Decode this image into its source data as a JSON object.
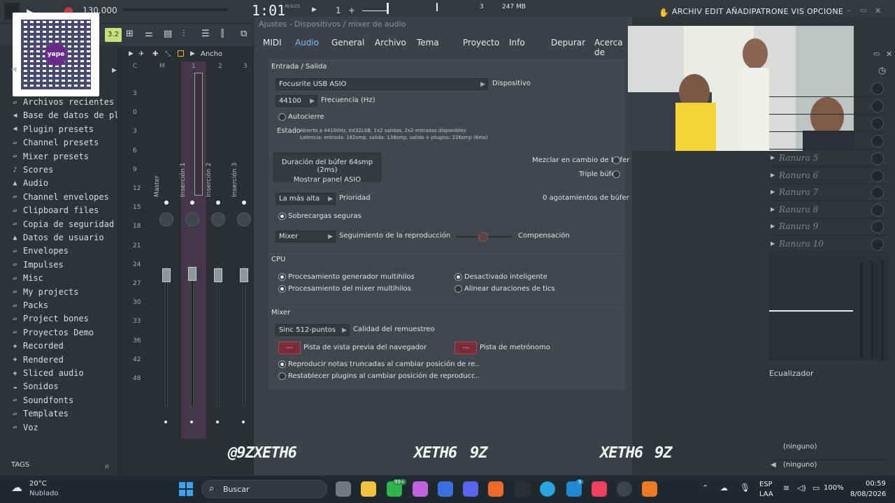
{
  "topbar": {
    "time_display": "1:01",
    "time_unit": "M:S:CS",
    "tempo": "130.000",
    "pattern": "1",
    "cpu_count": "3",
    "memory": "247 MB",
    "menu_title": "ARCHIV EDIT AÑADIPATRONE VIS OPCIONE HERRAMIENT A"
  },
  "toolbar": {
    "zoom_label": "3.2",
    "width_label": "Ancho"
  },
  "sidebar": {
    "qr_brand": "yape",
    "qr_caption": "Archivos recientes",
    "items": [
      {
        "icon": "folder-icon",
        "label": "Archivos recientes"
      },
      {
        "icon": "plug-icon",
        "label": "Base de datos de plugins"
      },
      {
        "icon": "plug-icon",
        "label": "Plugin presets"
      },
      {
        "icon": "folder-icon",
        "label": "Channel presets"
      },
      {
        "icon": "folder-icon",
        "label": "Mixer presets"
      },
      {
        "icon": "note-icon",
        "label": "Scores"
      },
      {
        "icon": "speaker-icon",
        "label": "Audio"
      },
      {
        "icon": "folder-icon",
        "label": "Channel envelopes"
      },
      {
        "icon": "folder-icon",
        "label": "Clipboard files"
      },
      {
        "icon": "folder-icon",
        "label": "Copia de seguridad"
      },
      {
        "icon": "user-icon",
        "label": "Datos de usuario"
      },
      {
        "icon": "folder-icon",
        "label": "Envelopes"
      },
      {
        "icon": "folder-icon",
        "label": "Impulses"
      },
      {
        "icon": "folder-icon",
        "label": "Misc"
      },
      {
        "icon": "folder-icon",
        "label": "My projects"
      },
      {
        "icon": "folder-icon",
        "label": "Packs"
      },
      {
        "icon": "folder-icon",
        "label": "Project bones"
      },
      {
        "icon": "folder-icon",
        "label": "Proyectos Demo"
      },
      {
        "icon": "plus-icon",
        "label": "Recorded"
      },
      {
        "icon": "plus-icon",
        "label": "Rendered"
      },
      {
        "icon": "plus-icon",
        "label": "Sliced audio"
      },
      {
        "icon": "cloud-icon",
        "label": "Sonidos"
      },
      {
        "icon": "folder-icon",
        "label": "Soundfonts"
      },
      {
        "icon": "folder-icon",
        "label": "Templates"
      },
      {
        "icon": "folder-icon",
        "label": "Voz"
      }
    ],
    "tags_label": "TAGS"
  },
  "mixer": {
    "col_labels": [
      "C",
      "M",
      "1",
      "2",
      "3"
    ],
    "db_marks": [
      "3",
      "0",
      "3",
      "6",
      "9",
      "12",
      "15",
      "18",
      "21",
      "24",
      "27",
      "30",
      "33",
      "36",
      "42",
      "48"
    ],
    "channels": [
      "Master",
      "Inserción 1",
      "Inserción 2",
      "Inserción 3"
    ]
  },
  "dialog": {
    "title": "Ajustes - Dispositivos / mixer de audio",
    "tabs": [
      "MIDI",
      "Audio",
      "General",
      "Archivo",
      "Tema",
      "Proyecto",
      "Info",
      "Depurar",
      "Acerca de"
    ],
    "active_tab": "Audio",
    "io": {
      "section": "Entrada / Salida",
      "device_value": "Focusrite USB ASIO",
      "device_label": "Dispositivo",
      "freq_value": "44100",
      "freq_label": "Frecuencia (Hz)",
      "autoclose": "Autocierre",
      "status_label": "Estado",
      "status_line1": "Abierto a 44100Hz, Int32LSB, 1x2 salidas, 2x2 entradas disponibles",
      "status_line2": "Latencia: entrada: 182smp, salida: 138smp, salida + plugins: 226smp (6ms)",
      "buffer_button_line1": "Duración del búfer 64smp (2ms)",
      "buffer_button_line2": "Mostrar panel ASIO",
      "mix_buffer": "Mezclar en cambio de búfer",
      "triple_buffer": "Triple búfer",
      "priority_value": "La más alta",
      "priority_label": "Prioridad",
      "underruns": "0 agotamientos de búfer",
      "safe_overloads": "Sobrecargas seguras",
      "tracking_value": "Mixer",
      "tracking_label": "Seguimiento de la reproducción",
      "offset_label": "Compensación"
    },
    "cpu": {
      "section": "CPU",
      "multithread_gen": "Procesamiento generador multihilos",
      "multithread_mixer": "Procesamiento del mixer multihilos",
      "smart_disable": "Desactivado inteligente",
      "align_ticks": "Alinear duraciones de tics"
    },
    "mixer": {
      "section": "Mixer",
      "resample_value": "Sinc 512-puntos",
      "resample_label": "Calidad del remuestreo",
      "preview_btn": "---",
      "preview_label": "Pista de vista previa del navegador",
      "metronome_btn": "---",
      "metronome_label": "Pista de metrónomo",
      "play_truncated": "Reproducir notas truncadas al cambiar posición de re..",
      "reset_plugins": "Restablecer plugins al cambiar posición de reproducc.."
    }
  },
  "right_panel": {
    "slots": [
      "Ranura 5",
      "Ranura 6",
      "Ranura 7",
      "Ranura 8",
      "Ranura 9",
      "Ranura 10"
    ],
    "eq_label": "Ecualizador",
    "route1": "(ninguno)",
    "route2": "(ninguno)"
  },
  "watermarks": [
    "@9ZXETH6",
    "XETH6",
    "9Z",
    "XETH6",
    "9Z"
  ],
  "taskbar": {
    "temp": "20°C",
    "weather": "Nublado",
    "search_placeholder": "Buscar",
    "badge_count": "99+",
    "badge2": "9",
    "lang1": "ESP",
    "lang2": "LAA",
    "battery": "100%",
    "time": "00:59",
    "date": "8/08/2026"
  },
  "colors": {
    "accent": "#7fb6ff",
    "mixer_highlight": "#5a3c5e",
    "red_button": "#7a2b3a"
  }
}
